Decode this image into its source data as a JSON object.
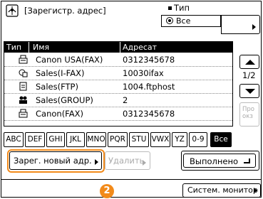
{
  "header": {
    "icon": "address-book-icon",
    "title": "[Зарегистр. адрес]",
    "type_label": "Тип",
    "type_value": "Все"
  },
  "table": {
    "columns": [
      "Тип",
      "Имя",
      "Адресат"
    ],
    "rows": [
      {
        "type_icon": "fax-icon",
        "name": "Canon USA(FAX)",
        "address": "0312345678"
      },
      {
        "type_icon": "ifax-icon",
        "name": "Sales(I-FAX)",
        "address": "10030ifax"
      },
      {
        "type_icon": "ftp-icon",
        "name": "Sales(FTP)",
        "address": "1004.ftphost"
      },
      {
        "type_icon": "group-icon",
        "name": "Sales(GROUP)",
        "address": "2"
      },
      {
        "type_icon": "fax-icon",
        "name": "Canon(FAX)",
        "address": "0312345678"
      }
    ]
  },
  "pagination": {
    "page": "1/2"
  },
  "detail_label": "Про окз",
  "letters": [
    "ABC",
    "DEF",
    "GHI",
    "JKL",
    "MNO",
    "PQR",
    "STU",
    "VWX",
    "YZ",
    "0-9",
    "Все"
  ],
  "selected_letter": "Все",
  "buttons": {
    "register": "Зарег. новый адр.",
    "delete": "Удалить",
    "done": "Выполнено",
    "system_monitor": "Систем. монитор"
  },
  "callout_number": "2",
  "colors": {
    "accent": "#f28a1a",
    "selected_bg": "#000000"
  }
}
